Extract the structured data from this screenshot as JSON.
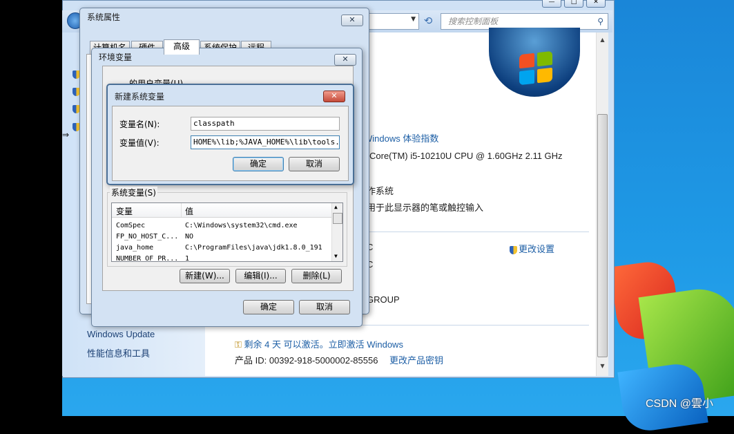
{
  "desktop": {
    "watermark": "CSDN @雲小"
  },
  "control_panel": {
    "window_buttons": [
      "—",
      "□",
      "✕"
    ],
    "search": {
      "placeholder": "搜索控制面板"
    },
    "main": {
      "rating_link": "Windows 体验指数",
      "processor": "Core(TM) i5-10210U CPU @ 1.60GHz   2.11 GHz",
      "system_type_fragment": "作系统",
      "pen_touch": "用于此显示器的笔或触控输入",
      "change_settings": "更改设置",
      "c_fragment_1": "C",
      "c_fragment_2": "C",
      "workgroup_fragment": "GROUP",
      "activation": "剩余 4 天 可以激活。立即激活 Windows",
      "product_id": "产品 ID: 00392-918-5000002-85556",
      "change_key": "更改产品密钥"
    },
    "sidebar": {
      "links": [
        "Windows Update",
        "性能信息和工具"
      ]
    }
  },
  "system_properties": {
    "title": "系统属性",
    "close": "✕",
    "tabs": [
      "计算机名",
      "硬件",
      "高级",
      "系统保护",
      "远程"
    ],
    "active_tab": "高级"
  },
  "env_vars": {
    "title": "环境变量",
    "close": "✕",
    "user_section_fragment": "的用户变量(U)",
    "system_section": "系统变量(S)",
    "columns": [
      "变量",
      "值"
    ],
    "rows": [
      {
        "name": "ComSpec",
        "value": "C:\\Windows\\system32\\cmd.exe"
      },
      {
        "name": "FP_NO_HOST_C...",
        "value": "NO"
      },
      {
        "name": "java_home",
        "value": "C:\\ProgramFiles\\java\\jdk1.8.0_191"
      },
      {
        "name": "NUMBER_OF_PR...",
        "value": "1"
      }
    ],
    "new_button": "新建(W)...",
    "edit_button": "编辑(I)...",
    "delete_button": "删除(L)",
    "ok_button": "确定",
    "cancel_button": "取消"
  },
  "new_var": {
    "title": "新建系统变量",
    "close": "✕",
    "name_label": "变量名(N):",
    "value_label": "变量值(V):",
    "name_value": "classpath",
    "value_value": "HOME%\\lib;%JAVA_HOME%\\lib\\tools.jar",
    "ok_button": "确定",
    "cancel_button": "取消"
  },
  "colors": {
    "accent": "#1c5ea5",
    "dialog_bg": "#d3e2f3",
    "desktop": "#1f9ae6"
  }
}
